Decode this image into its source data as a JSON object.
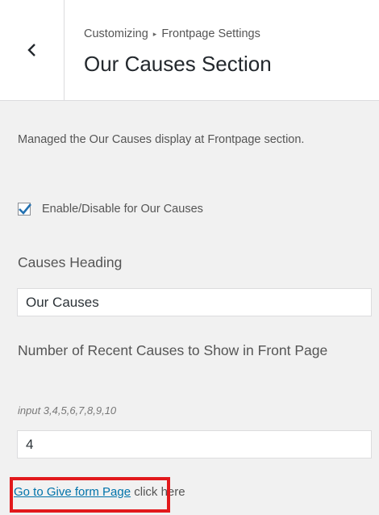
{
  "header": {
    "back_icon": "chevron-left-icon",
    "breadcrumb_root": "Customizing",
    "breadcrumb_separator": "▸",
    "breadcrumb_current": "Frontpage Settings",
    "title": "Our Causes Section"
  },
  "section": {
    "description": "Managed the Our Causes display at Frontpage section.",
    "enable_checkbox": {
      "label": "Enable/Disable for Our Causes",
      "checked": true
    },
    "heading_field": {
      "label": "Causes Heading",
      "value": "Our Causes"
    },
    "count_field": {
      "label": "Number of Recent Causes to Show in Front Page",
      "hint": "input 3,4,5,6,7,8,9,10",
      "value": "4"
    },
    "give_form": {
      "link_text": "Go to Give form Page",
      "suffix_text": " click here"
    }
  },
  "colors": {
    "highlight": "#e2191c",
    "link": "#0073aa",
    "checkmark": "#2271b1"
  }
}
